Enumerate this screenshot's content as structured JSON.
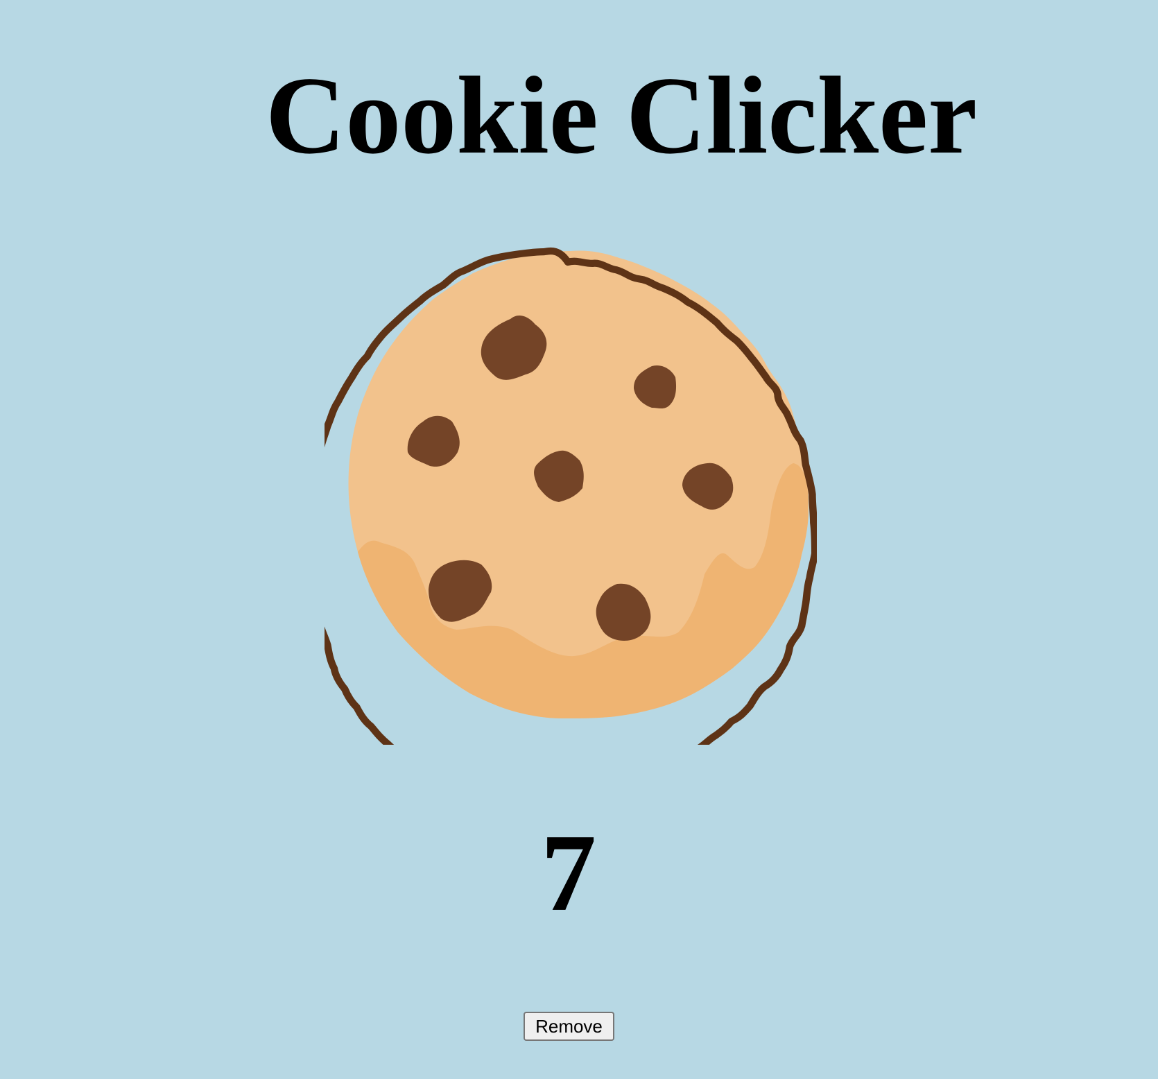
{
  "header": {
    "title": "Cookie Clicker"
  },
  "cookie": {
    "icon": "cookie-icon",
    "colors": {
      "dough": "#f2c28c",
      "dough_shade": "#efb472",
      "outline": "#5e3316",
      "chips": "#744427"
    }
  },
  "counter": {
    "value": "7"
  },
  "actions": {
    "remove_label": "Remove"
  },
  "colors": {
    "background": "#b7d8e4"
  }
}
